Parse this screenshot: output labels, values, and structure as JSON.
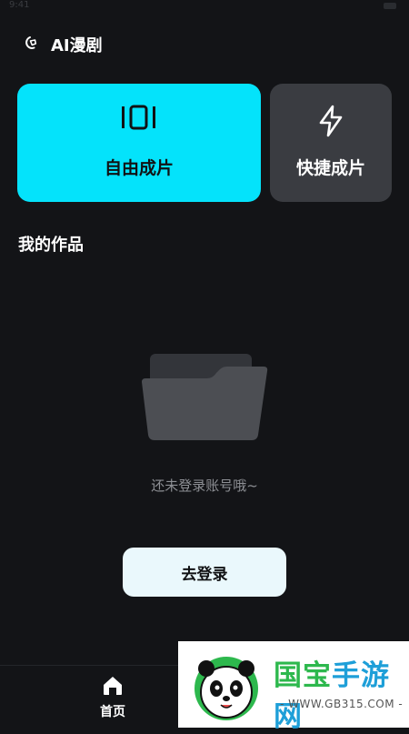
{
  "status_bar": {
    "time": "9:41"
  },
  "header": {
    "title": "AI漫剧",
    "icon": "app-logo-icon"
  },
  "cards": [
    {
      "label": "自由成片",
      "icon": "film-frames-icon",
      "bg": "#04e3fb"
    },
    {
      "label": "快捷成片",
      "icon": "lightning-icon",
      "bg": "#3a3c41"
    }
  ],
  "section": {
    "title": "我的作品"
  },
  "empty_state": {
    "text": "还未登录账号哦~",
    "icon": "folder-icon"
  },
  "login_button": {
    "label": "去登录"
  },
  "tab_bar": {
    "items": [
      {
        "label": "首页",
        "icon": "home-icon",
        "active": true
      }
    ]
  },
  "watermark": {
    "title_part1": "国宝",
    "title_part2": "手游网",
    "url": "- WWW.GB315.COM -"
  },
  "colors": {
    "background": "#131417",
    "accent": "#04e3fb",
    "card_secondary": "#3a3c41",
    "button_bg": "#eaf8fc"
  }
}
